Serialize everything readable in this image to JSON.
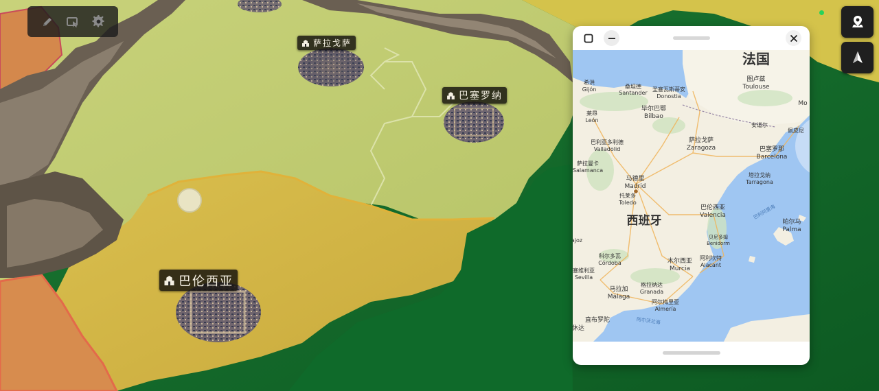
{
  "game_map": {
    "cities": [
      {
        "id": "zaragoza",
        "label": "萨拉戈萨"
      },
      {
        "id": "barcelona",
        "label": "巴塞罗纳"
      },
      {
        "id": "valencia",
        "label": "巴伦西亚"
      }
    ]
  },
  "toolbar": {
    "buttons": [
      {
        "name": "edit",
        "icon": "pencil-icon"
      },
      {
        "name": "select",
        "icon": "cursor-select-icon"
      },
      {
        "name": "settings",
        "icon": "gear-icon"
      }
    ]
  },
  "side_buttons": [
    {
      "name": "location",
      "icon": "map-pin-icon"
    },
    {
      "name": "compass",
      "icon": "navigation-arrow-icon"
    }
  ],
  "status": {
    "color": "#27d35a"
  },
  "minimap": {
    "controls": [
      "restore-icon",
      "minimize-icon",
      "close-icon"
    ],
    "labels": {
      "france": "法国",
      "spain": "西班牙",
      "toulouse_cn": "图卢兹",
      "toulouse": "Toulouse",
      "gijon_cn": "希洪",
      "gijon": "Gijón",
      "santander_cn": "桑坦德",
      "santander": "Santander",
      "donostia_cn": "圣塞瓦斯蒂安",
      "donostia": "Donostia",
      "monaco_cn": "Mo",
      "andorra": "安道尔",
      "perpignan": "佩皮尼",
      "bilbao_cn": "毕尔巴鄂",
      "bilbao": "Bilbao",
      "leon_cn": "莱昂",
      "leon": "León",
      "zaragoza_cn": "萨拉戈萨",
      "zaragoza": "Zaragoza",
      "valladolid_cn": "巴利亚多利德",
      "valladolid": "Valladolid",
      "barcelona_cn": "巴塞罗那",
      "barcelona": "Barcelona",
      "salamanca_cn": "萨拉曼卡",
      "salamanca": "Salamanca",
      "tarragona_cn": "塔拉戈纳",
      "tarragona": "Tarragona",
      "madrid_cn": "马德里",
      "madrid": "Madrid",
      "balearic_sea": "巴利阿里海",
      "toledo_cn": "托莱多",
      "toledo": "Toledo",
      "valencia_cn": "巴伦西亚",
      "valencia": "Valencia",
      "palma_cn": "帕尔马",
      "palma": "Palma",
      "benidorm_cn": "贝尼多姆",
      "benidorm": "Benidorm",
      "badajoz": "ajoz",
      "cordoba_cn": "科尔多瓦",
      "cordoba": "Córdoba",
      "murcia_cn": "木尔西亚",
      "murcia": "Murcia",
      "alicante_cn": "阿利坎特",
      "alicante": "Alacant",
      "sevilla_cn": "塞维利亚",
      "sevilla": "Sevilla",
      "malaga_cn": "马拉加",
      "malaga": "Málaga",
      "granada_cn": "格拉纳达",
      "granada": "Granada",
      "almeria_cn": "阿尔梅里亚",
      "almeria": "Almería",
      "gibraltar_cn": "直布罗陀",
      "alboran": "阿尔沃兰海",
      "ceuta": "休达"
    }
  }
}
